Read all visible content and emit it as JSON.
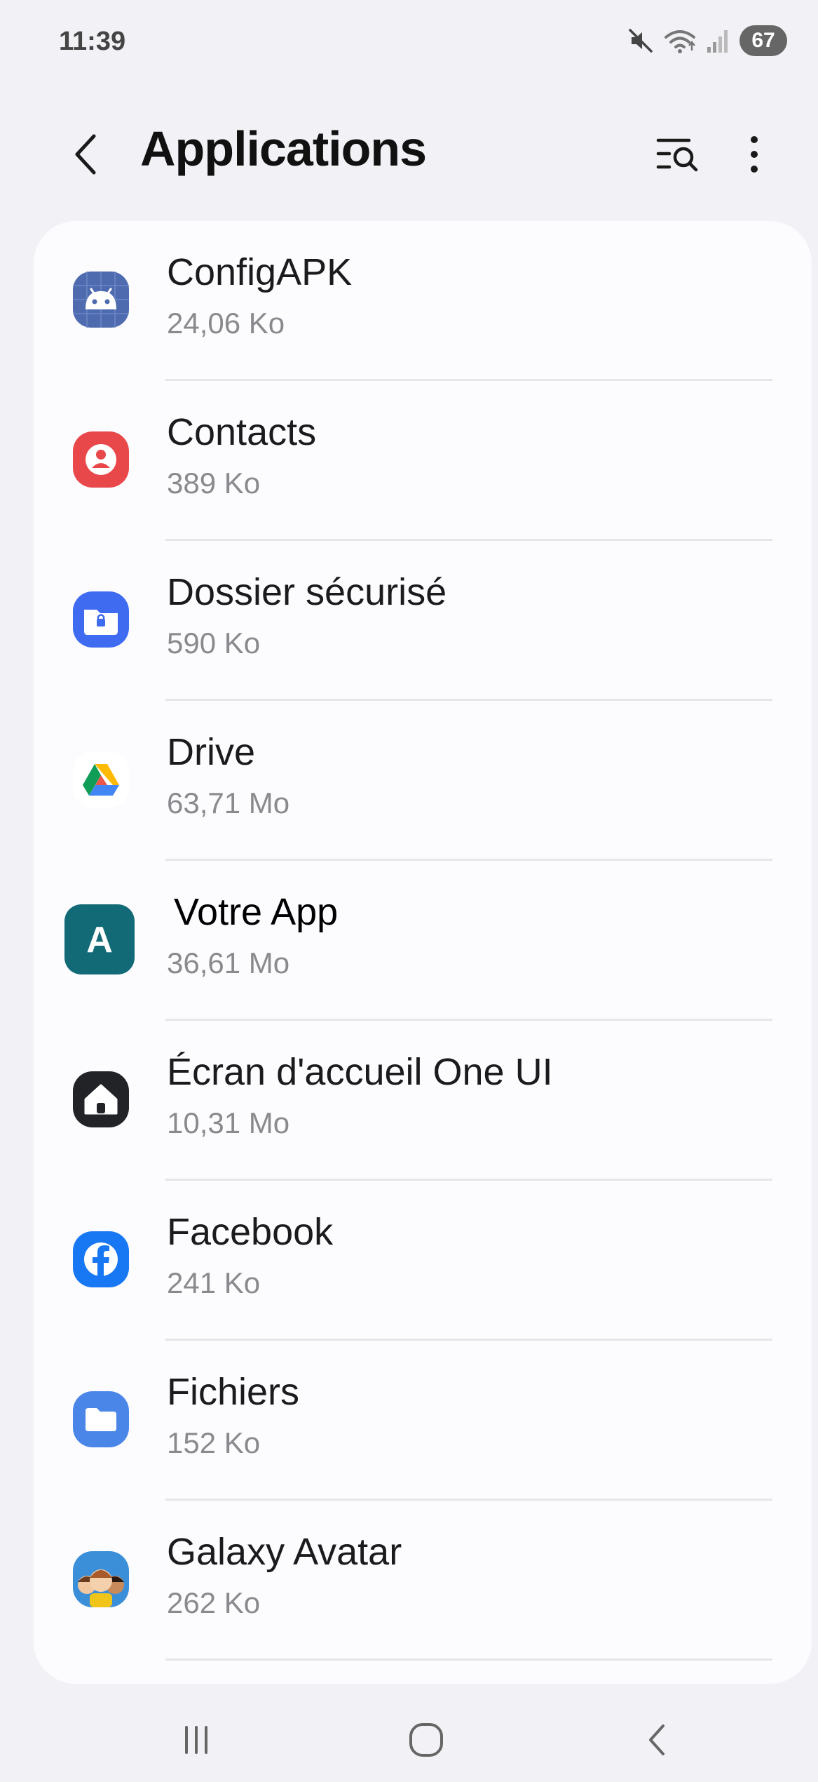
{
  "status_bar": {
    "time": "11:39",
    "battery_level": "67",
    "icons": [
      "mute-icon",
      "wifi-icon",
      "signal-icon",
      "battery-icon"
    ]
  },
  "header": {
    "title": "Applications",
    "back_icon": "chevron-left-icon",
    "search_icon": "list-search-icon",
    "more_icon": "more-vertical-icon"
  },
  "apps": [
    {
      "name": "ConfigAPK",
      "size": "24,06 Ko",
      "icon": "android-icon",
      "color": "#4f6bb0"
    },
    {
      "name": "Contacts",
      "size": "389 Ko",
      "icon": "contacts-icon",
      "color": "#e8484a"
    },
    {
      "name": "Dossier sécurisé",
      "size": "590 Ko",
      "icon": "secure-folder-icon",
      "color": "#3f6bf0"
    },
    {
      "name": "Drive",
      "size": "63,71 Mo",
      "icon": "drive-icon",
      "color": "#ffffff"
    },
    {
      "name": "Votre App",
      "size": "36,61 Mo",
      "icon": "app-a-icon",
      "color": "#116a76"
    },
    {
      "name": "Écran d'accueil One UI",
      "size": "10,31 Mo",
      "icon": "home-icon",
      "color": "#222327"
    },
    {
      "name": "Facebook",
      "size": "241 Ko",
      "icon": "facebook-icon",
      "color": "#1877f2"
    },
    {
      "name": "Fichiers",
      "size": "152 Ko",
      "icon": "folder-icon",
      "color": "#4a86e8"
    },
    {
      "name": "Galaxy Avatar",
      "size": "262 Ko",
      "icon": "avatar-icon",
      "color": "#3a8fd8"
    }
  ],
  "nav_bar": {
    "recents_icon": "recents-icon",
    "home_icon": "home-button-icon",
    "back_icon": "back-icon"
  },
  "colors": {
    "background": "#f2f2f6",
    "card": "#fcfcff",
    "secondary_text": "#8a8a8e"
  }
}
